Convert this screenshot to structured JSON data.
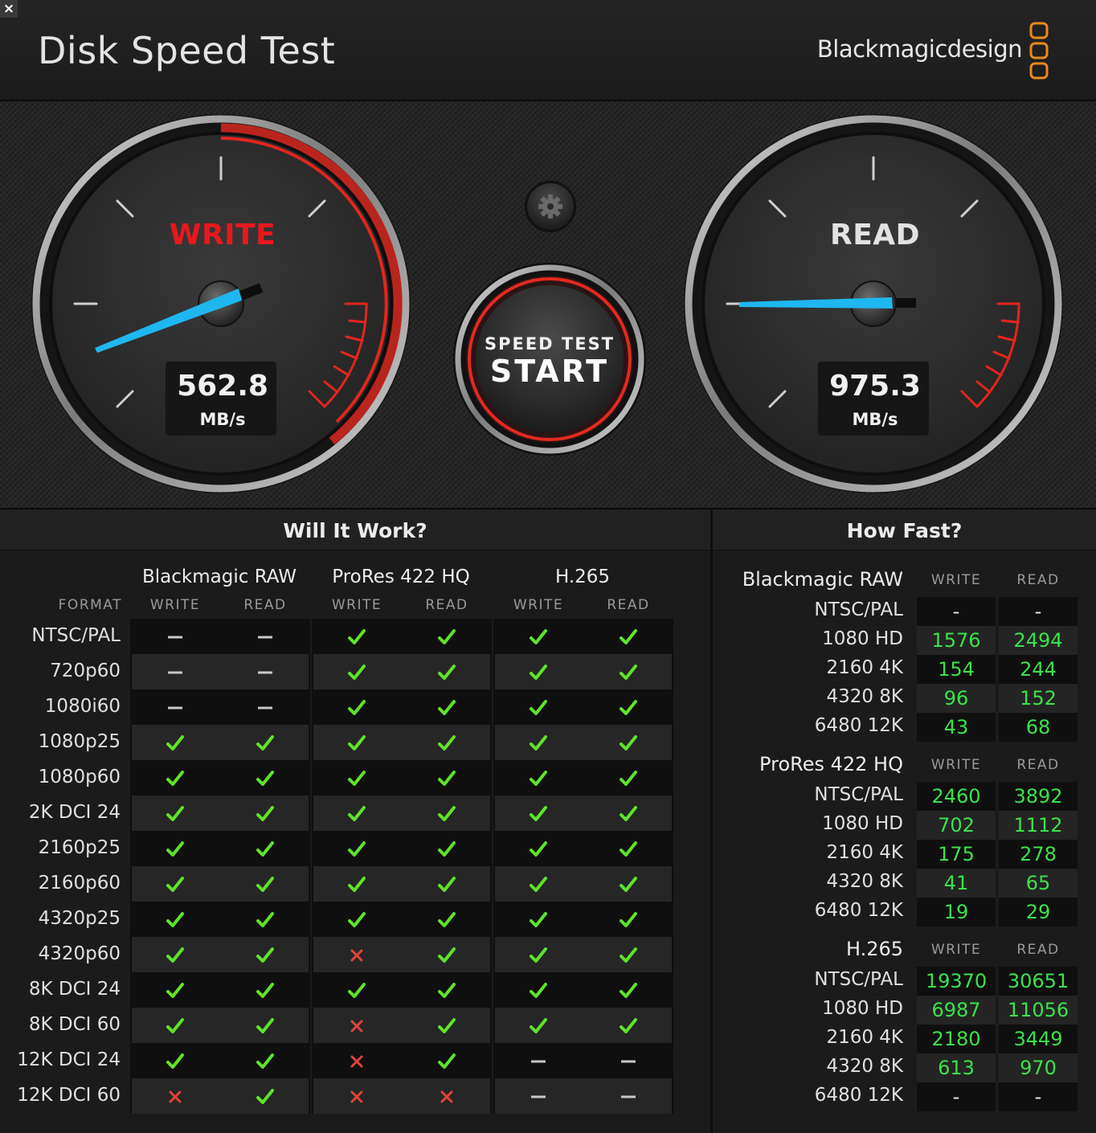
{
  "window": {
    "close_label": "×"
  },
  "header": {
    "title": "Disk Speed Test",
    "brand": "Blackmagicdesign"
  },
  "gauges": {
    "write": {
      "label": "WRITE",
      "value": "562.8",
      "unit": "MB/s",
      "label_color": "#e8181c"
    },
    "read": {
      "label": "READ",
      "value": "975.3",
      "unit": "MB/s",
      "label_color": "#e2e2e2"
    }
  },
  "start_button": {
    "subtitle": "SPEED TEST",
    "label": "START"
  },
  "will_it_work": {
    "title": "Will It Work?",
    "format_header": "FORMAT",
    "groups": [
      {
        "name": "Blackmagic RAW",
        "write": "WRITE",
        "read": "READ"
      },
      {
        "name": "ProRes 422 HQ",
        "write": "WRITE",
        "read": "READ"
      },
      {
        "name": "H.265",
        "write": "WRITE",
        "read": "READ"
      }
    ],
    "rows": [
      {
        "format": "NTSC/PAL",
        "marks": [
          "dash",
          "dash",
          "check",
          "check",
          "check",
          "check"
        ]
      },
      {
        "format": "720p60",
        "marks": [
          "dash",
          "dash",
          "check",
          "check",
          "check",
          "check"
        ]
      },
      {
        "format": "1080i60",
        "marks": [
          "dash",
          "dash",
          "check",
          "check",
          "check",
          "check"
        ]
      },
      {
        "format": "1080p25",
        "marks": [
          "check",
          "check",
          "check",
          "check",
          "check",
          "check"
        ]
      },
      {
        "format": "1080p60",
        "marks": [
          "check",
          "check",
          "check",
          "check",
          "check",
          "check"
        ]
      },
      {
        "format": "2K DCI 24",
        "marks": [
          "check",
          "check",
          "check",
          "check",
          "check",
          "check"
        ]
      },
      {
        "format": "2160p25",
        "marks": [
          "check",
          "check",
          "check",
          "check",
          "check",
          "check"
        ]
      },
      {
        "format": "2160p60",
        "marks": [
          "check",
          "check",
          "check",
          "check",
          "check",
          "check"
        ]
      },
      {
        "format": "4320p25",
        "marks": [
          "check",
          "check",
          "check",
          "check",
          "check",
          "check"
        ]
      },
      {
        "format": "4320p60",
        "marks": [
          "check",
          "check",
          "cross",
          "check",
          "check",
          "check"
        ]
      },
      {
        "format": "8K DCI 24",
        "marks": [
          "check",
          "check",
          "check",
          "check",
          "check",
          "check"
        ]
      },
      {
        "format": "8K DCI 60",
        "marks": [
          "check",
          "check",
          "cross",
          "check",
          "check",
          "check"
        ]
      },
      {
        "format": "12K DCI 24",
        "marks": [
          "check",
          "check",
          "cross",
          "check",
          "dash",
          "dash"
        ]
      },
      {
        "format": "12K DCI 60",
        "marks": [
          "cross",
          "check",
          "cross",
          "cross",
          "dash",
          "dash"
        ]
      }
    ]
  },
  "how_fast": {
    "title": "How Fast?",
    "sections": [
      {
        "name": "Blackmagic RAW",
        "write": "WRITE",
        "read": "READ",
        "rows": [
          {
            "format": "NTSC/PAL",
            "write": "-",
            "read": "-"
          },
          {
            "format": "1080 HD",
            "write": "1576",
            "read": "2494"
          },
          {
            "format": "2160 4K",
            "write": "154",
            "read": "244"
          },
          {
            "format": "4320 8K",
            "write": "96",
            "read": "152"
          },
          {
            "format": "6480 12K",
            "write": "43",
            "read": "68"
          }
        ]
      },
      {
        "name": "ProRes 422 HQ",
        "write": "WRITE",
        "read": "READ",
        "rows": [
          {
            "format": "NTSC/PAL",
            "write": "2460",
            "read": "3892"
          },
          {
            "format": "1080 HD",
            "write": "702",
            "read": "1112"
          },
          {
            "format": "2160 4K",
            "write": "175",
            "read": "278"
          },
          {
            "format": "4320 8K",
            "write": "41",
            "read": "65"
          },
          {
            "format": "6480 12K",
            "write": "19",
            "read": "29"
          }
        ]
      },
      {
        "name": "H.265",
        "write": "WRITE",
        "read": "READ",
        "rows": [
          {
            "format": "NTSC/PAL",
            "write": "19370",
            "read": "30651"
          },
          {
            "format": "1080 HD",
            "write": "6987",
            "read": "11056"
          },
          {
            "format": "2160 4K",
            "write": "2180",
            "read": "3449"
          },
          {
            "format": "4320 8K",
            "write": "613",
            "read": "970"
          },
          {
            "format": "6480 12K",
            "write": "-",
            "read": "-"
          }
        ]
      }
    ]
  },
  "colors": {
    "check": "#5fe32a",
    "cross": "#e0443a",
    "dash": "#c8c8c8",
    "value": "#3be24b",
    "needle": "#1fb7f0",
    "accent_red": "#e2261e",
    "logo_orange": "#e98a1c"
  },
  "icons": {
    "settings": "gear-icon",
    "check": "check-icon",
    "cross": "cross-icon",
    "dash": "dash-icon"
  }
}
